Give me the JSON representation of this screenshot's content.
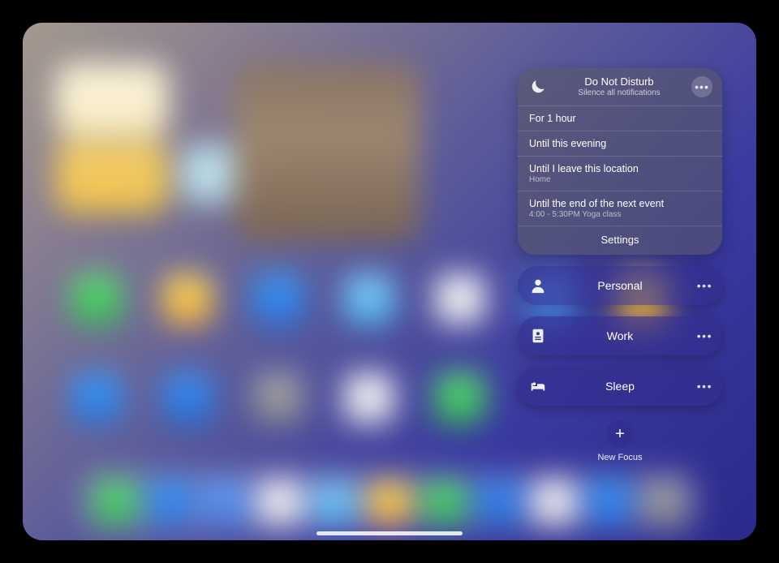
{
  "dnd": {
    "title": "Do Not Disturb",
    "subtitle": "Silence all notifications",
    "options": [
      {
        "label": "For 1 hour"
      },
      {
        "label": "Until this evening"
      },
      {
        "label": "Until I leave this location",
        "sub": "Home"
      },
      {
        "label": "Until the end of the next event",
        "sub": "4:00 - 5:30PM Yoga class"
      }
    ],
    "settings_label": "Settings"
  },
  "focus_modes": [
    {
      "icon": "person",
      "label": "Personal"
    },
    {
      "icon": "badge",
      "label": "Work"
    },
    {
      "icon": "bed",
      "label": "Sleep"
    }
  ],
  "new_focus": {
    "plus": "+",
    "label": "New Focus"
  }
}
